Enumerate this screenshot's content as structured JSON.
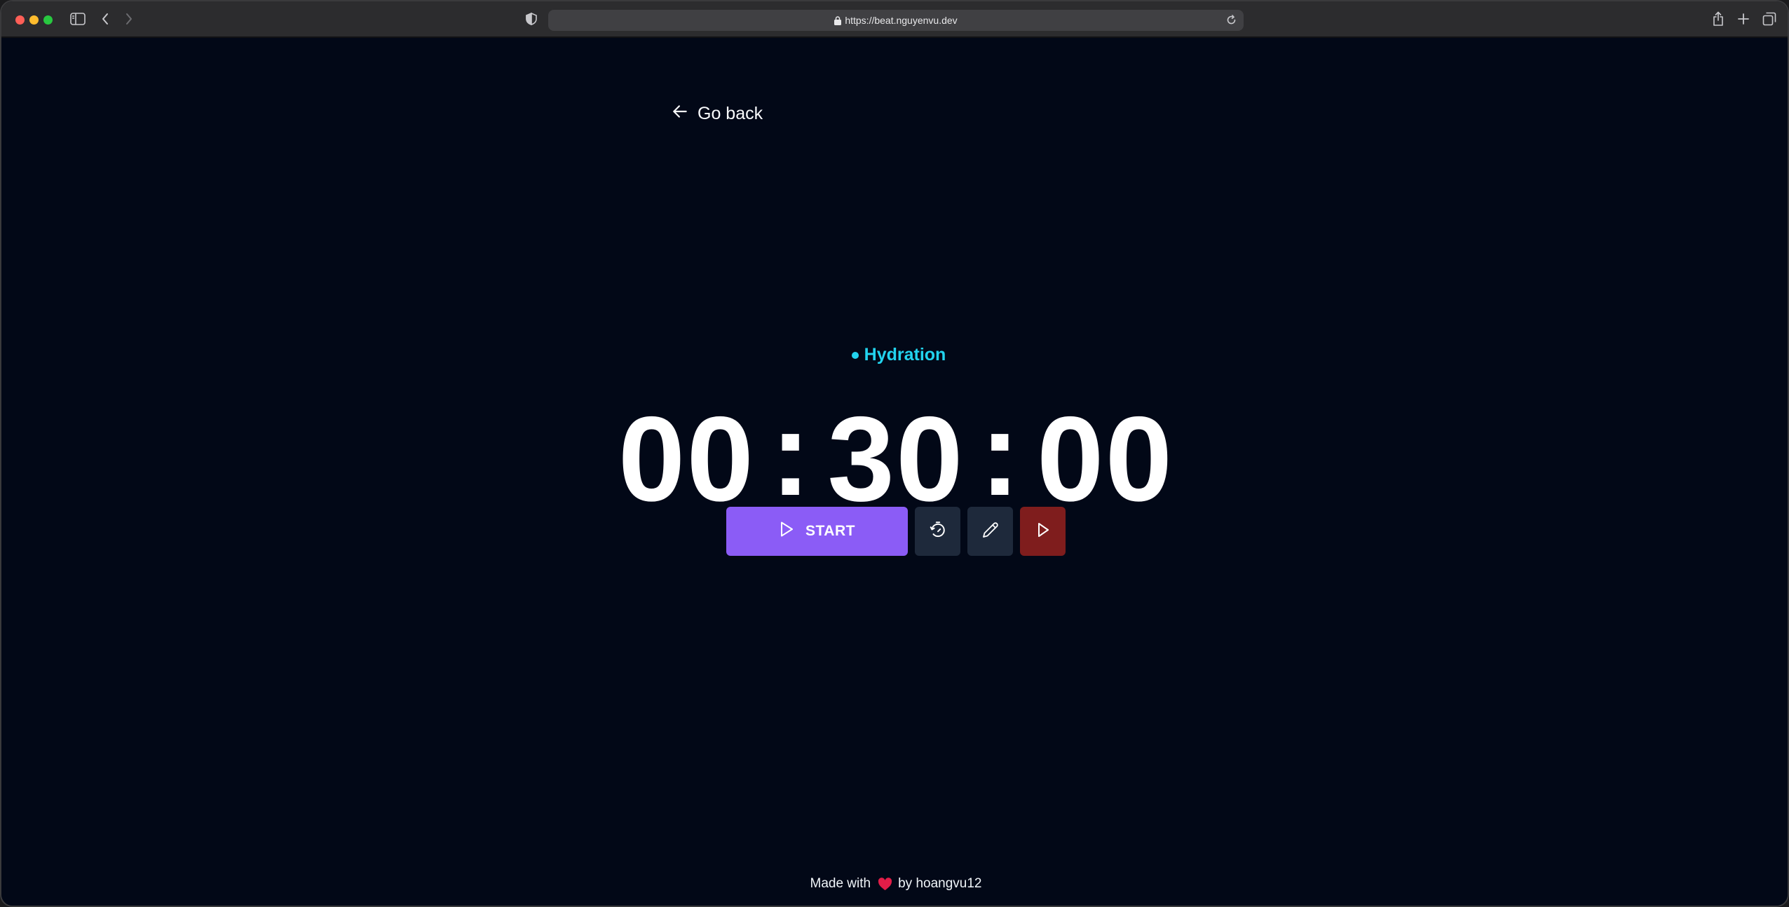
{
  "browser": {
    "url": "https://beat.nguyenvu.dev"
  },
  "page": {
    "go_back_label": "Go back",
    "timer_label": "Hydration",
    "time": {
      "hours": "00",
      "minutes": "30",
      "seconds": "00",
      "separator": ":"
    },
    "start_label": "START",
    "footer": {
      "prefix": "Made with",
      "suffix": "by hoangvu12"
    }
  },
  "colors": {
    "background": "#020817",
    "accent_label": "#22d3ee",
    "start_button": "#8b5cf6",
    "secondary_button": "#1e293b",
    "danger_button": "#7f1d1d",
    "heart": "#e11d48"
  },
  "icons": {
    "go_back": "arrow-left-icon",
    "start": "play-icon",
    "reset": "timer-reset-icon",
    "edit": "pencil-icon",
    "sound": "play-icon"
  }
}
